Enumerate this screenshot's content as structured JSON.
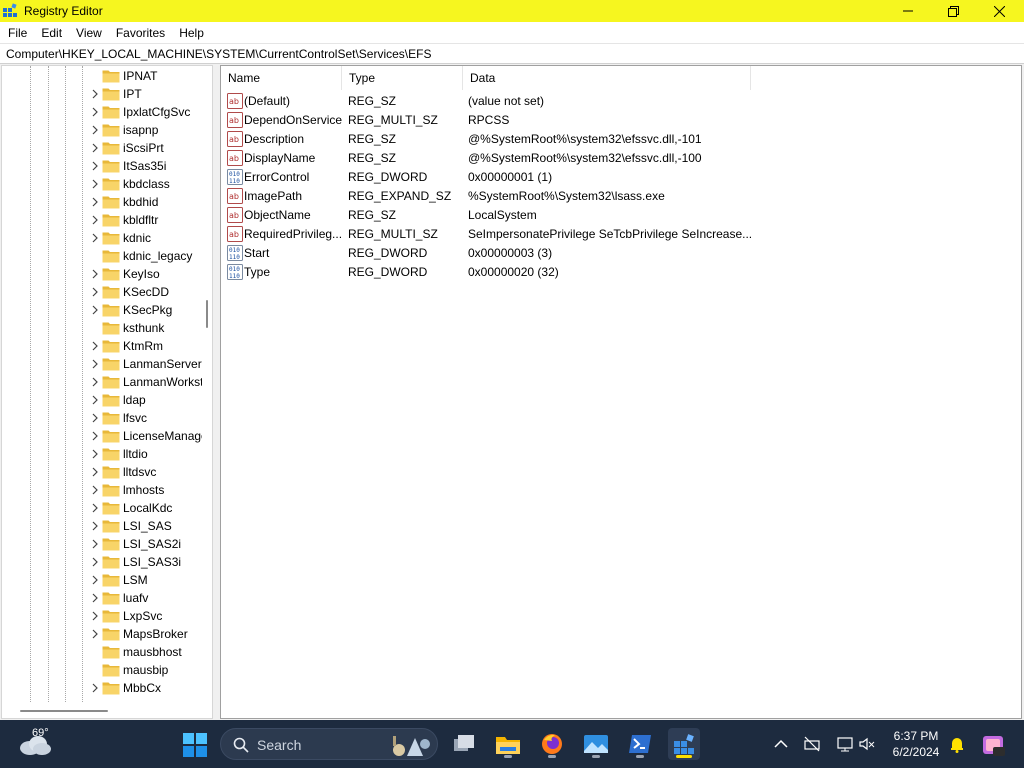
{
  "window": {
    "title": "Registry Editor",
    "title_bar_color": "#f6f61f"
  },
  "menu": [
    "File",
    "Edit",
    "View",
    "Favorites",
    "Help"
  ],
  "address": "Computer\\HKEY_LOCAL_MACHINE\\SYSTEM\\CurrentControlSet\\Services\\EFS",
  "tree": {
    "items": [
      {
        "label": "IPNAT",
        "expandable": false
      },
      {
        "label": "IPT",
        "expandable": true
      },
      {
        "label": "IpxlatCfgSvc",
        "expandable": true
      },
      {
        "label": "isapnp",
        "expandable": true
      },
      {
        "label": "iScsiPrt",
        "expandable": true
      },
      {
        "label": "ItSas35i",
        "expandable": true
      },
      {
        "label": "kbdclass",
        "expandable": true
      },
      {
        "label": "kbdhid",
        "expandable": true
      },
      {
        "label": "kbldfltr",
        "expandable": true
      },
      {
        "label": "kdnic",
        "expandable": true
      },
      {
        "label": "kdnic_legacy",
        "expandable": false
      },
      {
        "label": "KeyIso",
        "expandable": true
      },
      {
        "label": "KSecDD",
        "expandable": true
      },
      {
        "label": "KSecPkg",
        "expandable": true
      },
      {
        "label": "ksthunk",
        "expandable": false
      },
      {
        "label": "KtmRm",
        "expandable": true
      },
      {
        "label": "LanmanServer",
        "expandable": true
      },
      {
        "label": "LanmanWorkstation",
        "expandable": true
      },
      {
        "label": "ldap",
        "expandable": true
      },
      {
        "label": "lfsvc",
        "expandable": true
      },
      {
        "label": "LicenseManager",
        "expandable": true
      },
      {
        "label": "lltdio",
        "expandable": true
      },
      {
        "label": "lltdsvc",
        "expandable": true
      },
      {
        "label": "lmhosts",
        "expandable": true
      },
      {
        "label": "LocalKdc",
        "expandable": true
      },
      {
        "label": "LSI_SAS",
        "expandable": true
      },
      {
        "label": "LSI_SAS2i",
        "expandable": true
      },
      {
        "label": "LSI_SAS3i",
        "expandable": true
      },
      {
        "label": "LSM",
        "expandable": true
      },
      {
        "label": "luafv",
        "expandable": true
      },
      {
        "label": "LxpSvc",
        "expandable": true
      },
      {
        "label": "MapsBroker",
        "expandable": true
      },
      {
        "label": "mausbhost",
        "expandable": false
      },
      {
        "label": "mausbip",
        "expandable": false
      },
      {
        "label": "MbbCx",
        "expandable": true
      }
    ]
  },
  "values": {
    "columns": [
      "Name",
      "Type",
      "Data"
    ],
    "rows": [
      {
        "name": "(Default)",
        "type": "REG_SZ",
        "data": "(value not set)",
        "icon": "string-value-icon"
      },
      {
        "name": "DependOnService",
        "type": "REG_MULTI_SZ",
        "data": "RPCSS",
        "icon": "string-value-icon"
      },
      {
        "name": "Description",
        "type": "REG_SZ",
        "data": "@%SystemRoot%\\system32\\efssvc.dll,-101",
        "icon": "string-value-icon"
      },
      {
        "name": "DisplayName",
        "type": "REG_SZ",
        "data": "@%SystemRoot%\\system32\\efssvc.dll,-100",
        "icon": "string-value-icon"
      },
      {
        "name": "ErrorControl",
        "type": "REG_DWORD",
        "data": "0x00000001 (1)",
        "icon": "binary-value-icon"
      },
      {
        "name": "ImagePath",
        "type": "REG_EXPAND_SZ",
        "data": "%SystemRoot%\\System32\\lsass.exe",
        "icon": "string-value-icon"
      },
      {
        "name": "ObjectName",
        "type": "REG_SZ",
        "data": "LocalSystem",
        "icon": "string-value-icon"
      },
      {
        "name": "RequiredPrivileg...",
        "type": "REG_MULTI_SZ",
        "data": "SeImpersonatePrivilege SeTcbPrivilege SeIncrease...",
        "icon": "string-value-icon"
      },
      {
        "name": "Start",
        "type": "REG_DWORD",
        "data": "0x00000003 (3)",
        "icon": "binary-value-icon"
      },
      {
        "name": "Type",
        "type": "REG_DWORD",
        "data": "0x00000020 (32)",
        "icon": "binary-value-icon"
      }
    ]
  },
  "taskbar": {
    "temperature": "69°",
    "search_placeholder": "Search",
    "time": "6:37 PM",
    "date": "6/2/2024",
    "background": "#1d2b3f"
  }
}
